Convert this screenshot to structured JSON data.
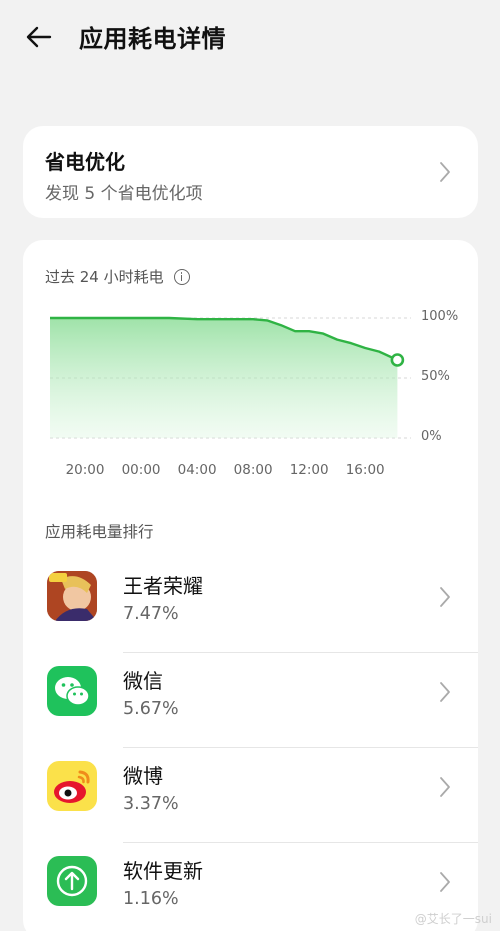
{
  "header": {
    "title": "应用耗电详情",
    "back_icon": "arrow-left-icon"
  },
  "optimization": {
    "title": "省电优化",
    "subtitle": "发现 5 个省电优化项"
  },
  "usage": {
    "title": "过去 24 小时耗电"
  },
  "chart_data": {
    "type": "area",
    "title": "",
    "x_ticks": [
      "20:00",
      "00:00",
      "04:00",
      "08:00",
      "12:00",
      "16:00"
    ],
    "y_ticks": [
      "100%",
      "50%",
      "0%"
    ],
    "ylim": [
      0,
      100
    ],
    "grid": true,
    "series": [
      {
        "color": "#2fb344",
        "x": [
          17.5,
          20,
          22,
          0,
          2,
          4,
          6,
          8,
          9,
          10,
          11,
          12,
          13,
          14,
          15,
          16,
          17,
          18.3
        ],
        "x_hours_elapsed": [
          0,
          2.5,
          4.5,
          6.5,
          8.5,
          10.5,
          12.5,
          14.5,
          15.5,
          16.5,
          17.5,
          18.5,
          19.5,
          20.5,
          21.5,
          22.5,
          23.5,
          24.8
        ],
        "values": [
          100,
          100,
          100,
          100,
          100,
          99,
          99,
          99,
          98,
          94,
          89,
          89,
          87,
          82,
          79,
          75,
          72,
          65
        ]
      }
    ]
  },
  "ranking": {
    "title": "应用耗电量排行",
    "apps": [
      {
        "name": "王者荣耀",
        "percent": "7.47%",
        "icon": "honor-of-kings-icon"
      },
      {
        "name": "微信",
        "percent": "5.67%",
        "icon": "wechat-icon"
      },
      {
        "name": "微博",
        "percent": "3.37%",
        "icon": "weibo-icon"
      },
      {
        "name": "软件更新",
        "percent": "1.16%",
        "icon": "software-update-icon"
      }
    ]
  },
  "watermark": "@艾长了一sui"
}
